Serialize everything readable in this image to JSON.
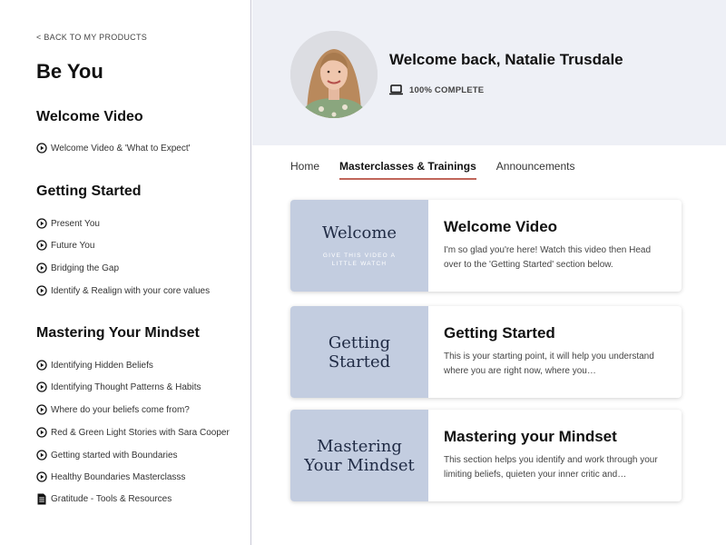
{
  "sidebar": {
    "back_label": "< BACK TO MY PRODUCTS",
    "product_title": "Be You",
    "sections": [
      {
        "title": "Welcome Video",
        "lessons": [
          {
            "label": "Welcome Video & 'What to Expect'",
            "icon": "play-circle-icon"
          }
        ]
      },
      {
        "title": "Getting Started",
        "lessons": [
          {
            "label": "Present You",
            "icon": "play-circle-icon"
          },
          {
            "label": "Future You",
            "icon": "play-circle-icon"
          },
          {
            "label": "Bridging the Gap",
            "icon": "play-circle-icon"
          },
          {
            "label": "Identify & Realign with your core values",
            "icon": "play-circle-icon"
          }
        ]
      },
      {
        "title": "Mastering Your Mindset",
        "lessons": [
          {
            "label": "Identifying Hidden Beliefs",
            "icon": "play-circle-icon"
          },
          {
            "label": "Identifying Thought Patterns & Habits",
            "icon": "play-circle-icon"
          },
          {
            "label": "Where do your beliefs come from?",
            "icon": "play-circle-icon"
          },
          {
            "label": "Red & Green Light Stories with Sara Cooper",
            "icon": "play-circle-icon"
          },
          {
            "label": "Getting started with Boundaries",
            "icon": "play-circle-icon"
          },
          {
            "label": "Healthy Boundaries Masterclasss",
            "icon": "play-circle-icon"
          },
          {
            "label": "Gratitude - Tools & Resources",
            "icon": "document-icon"
          }
        ]
      }
    ]
  },
  "header": {
    "welcome": "Welcome back, Natalie Trusdale",
    "progress_label": "100% COMPLETE"
  },
  "tabs": [
    {
      "label": "Home",
      "active": false
    },
    {
      "label": "Masterclasses & Trainings",
      "active": true
    },
    {
      "label": "Announcements",
      "active": false
    }
  ],
  "cards": [
    {
      "thumb_title": "Welcome",
      "thumb_subtitle": "GIVE THIS VIDEO A LITTLE WATCH",
      "title": "Welcome Video",
      "description": "I'm so glad you're here! Watch this video then Head over to the 'Getting Started' section below."
    },
    {
      "thumb_title": "Getting Started",
      "thumb_subtitle": "",
      "title": "Getting Started",
      "description": "This is your starting point, it will help you understand where you are right now, where you…"
    },
    {
      "thumb_title": "Mastering Your Mindset",
      "thumb_subtitle": "",
      "title": "Mastering your Mindset",
      "description": "This section helps you identify and work through your limiting beliefs, quieten your inner critic and…"
    }
  ],
  "colors": {
    "hero_bg": "#eef0f6",
    "thumb_bg": "#c3cde0",
    "tab_underline": "#c0665a"
  }
}
